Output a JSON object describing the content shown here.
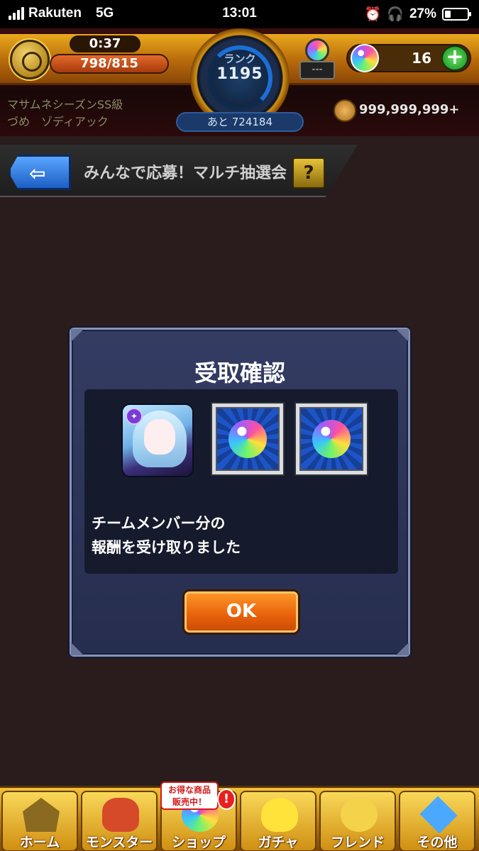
{
  "status_bar": {
    "carrier": "Rakuten",
    "network": "5G",
    "time": "13:01",
    "battery": "27%",
    "battery_level": 0.27
  },
  "header": {
    "timer": "0:37",
    "stamina": "798/815",
    "rank_label": "ランク",
    "rank_value": "1195",
    "rank_next": "あと 724184",
    "lamp_text": "---",
    "orb_count": "16",
    "plus_label": "+",
    "title_line1": "マサムネシーズンSS級",
    "title_line2": "づめ　ゾディアック",
    "coins": "999,999,999+"
  },
  "page": {
    "title": "みんなで応募！マルチ抽選会",
    "back_arrow": "⇦",
    "help_label": "?"
  },
  "dialog": {
    "title": "受取確認",
    "message_line1": "チームメンバー分の",
    "message_line2": "報酬を受け取りました",
    "ok_label": "OK",
    "char_badge": "✦"
  },
  "nav": {
    "items": [
      {
        "label": "ホーム",
        "icon": "home-icon"
      },
      {
        "label": "モンスター",
        "icon": "monster-icon"
      },
      {
        "label": "ショップ",
        "icon": "shop-icon"
      },
      {
        "label": "ガチャ",
        "icon": "gacha-icon"
      },
      {
        "label": "フレンド",
        "icon": "friend-icon"
      },
      {
        "label": "その他",
        "icon": "other-icon"
      }
    ],
    "sale_badge_line1": "お得な商品",
    "sale_badge_line2": "販売中！",
    "alert_badge": "!"
  },
  "colors": {
    "accent_orange": "#e8600a",
    "dialog_bg": "#2e3558",
    "header_gold": "#e9a91d"
  }
}
